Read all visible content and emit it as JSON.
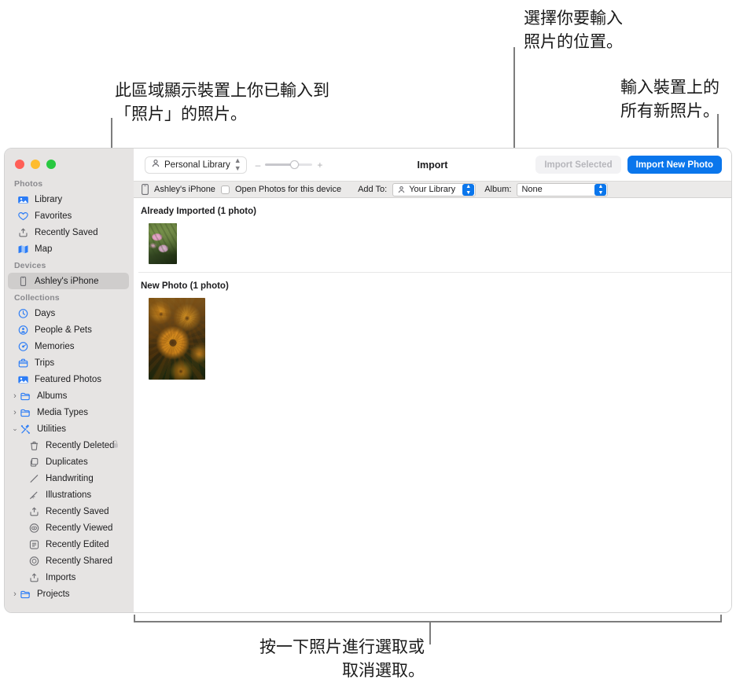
{
  "annotations": {
    "left_top": "此區域顯示裝置上你已輸入到\n「照片」的照片。",
    "top_center": "選擇你要輸入\n照片的位置。",
    "top_right": "輸入裝置上的\n所有新照片。",
    "bottom": "按一下照片進行選取或\n取消選取。"
  },
  "window": {
    "traffic_lights": [
      "close",
      "minimize",
      "zoom"
    ],
    "toolbar": {
      "library_popup": "Personal Library",
      "zoom_minus": "–",
      "zoom_plus": "+",
      "title": "Import",
      "import_selected_label": "Import Selected",
      "import_new_label": "Import New Photo",
      "accent_color": "#0a76ec"
    },
    "import_bar": {
      "device_name": "Ashley's iPhone",
      "open_photos_checkbox_label": "Open Photos for this device",
      "open_photos_checked": false,
      "add_to_label": "Add To:",
      "add_to_value": "Your Library",
      "album_label": "Album:",
      "album_value": "None"
    },
    "sidebar": {
      "sections": [
        {
          "title": "Photos",
          "items": [
            {
              "label": "Library",
              "icon": "library-icon",
              "indent": false,
              "disclosure": null,
              "selected": false
            },
            {
              "label": "Favorites",
              "icon": "heart-icon",
              "indent": false,
              "disclosure": null,
              "selected": false
            },
            {
              "label": "Recently Saved",
              "icon": "tray-up-icon",
              "indent": false,
              "disclosure": null,
              "selected": false
            },
            {
              "label": "Map",
              "icon": "map-icon",
              "indent": false,
              "disclosure": null,
              "selected": false
            }
          ]
        },
        {
          "title": "Devices",
          "items": [
            {
              "label": "Ashley's iPhone",
              "icon": "iphone-icon",
              "indent": false,
              "disclosure": null,
              "selected": true
            }
          ]
        },
        {
          "title": "Collections",
          "items": [
            {
              "label": "Days",
              "icon": "clock-icon",
              "indent": false,
              "disclosure": null,
              "selected": false
            },
            {
              "label": "People & Pets",
              "icon": "person-icon",
              "indent": false,
              "disclosure": null,
              "selected": false
            },
            {
              "label": "Memories",
              "icon": "memories-icon",
              "indent": false,
              "disclosure": null,
              "selected": false
            },
            {
              "label": "Trips",
              "icon": "suitcase-icon",
              "indent": false,
              "disclosure": null,
              "selected": false
            },
            {
              "label": "Featured Photos",
              "icon": "featured-icon",
              "indent": false,
              "disclosure": null,
              "selected": false
            },
            {
              "label": "Albums",
              "icon": "folder-icon",
              "indent": false,
              "disclosure": "right",
              "selected": false
            },
            {
              "label": "Media Types",
              "icon": "folder-icon",
              "indent": false,
              "disclosure": "right",
              "selected": false
            },
            {
              "label": "Utilities",
              "icon": "tools-icon",
              "indent": false,
              "disclosure": "down",
              "selected": false
            },
            {
              "label": "Recently Deleted",
              "icon": "trash-icon",
              "indent": true,
              "disclosure": null,
              "selected": false,
              "badge": "lock-icon"
            },
            {
              "label": "Duplicates",
              "icon": "duplicate-icon",
              "indent": true,
              "disclosure": null,
              "selected": false
            },
            {
              "label": "Handwriting",
              "icon": "pen-icon",
              "indent": true,
              "disclosure": null,
              "selected": false
            },
            {
              "label": "Illustrations",
              "icon": "illustration-icon",
              "indent": true,
              "disclosure": null,
              "selected": false
            },
            {
              "label": "Recently Saved",
              "icon": "tray-up-icon",
              "indent": true,
              "disclosure": null,
              "selected": false
            },
            {
              "label": "Recently Viewed",
              "icon": "eye-circle-icon",
              "indent": true,
              "disclosure": null,
              "selected": false
            },
            {
              "label": "Recently Edited",
              "icon": "edit-square-icon",
              "indent": true,
              "disclosure": null,
              "selected": false
            },
            {
              "label": "Recently Shared",
              "icon": "share-circle-icon",
              "indent": true,
              "disclosure": null,
              "selected": false
            },
            {
              "label": "Imports",
              "icon": "tray-up-icon",
              "indent": true,
              "disclosure": null,
              "selected": false
            },
            {
              "label": "Projects",
              "icon": "folder-icon",
              "indent": false,
              "disclosure": "right",
              "selected": false
            }
          ]
        }
      ]
    },
    "content": {
      "groups": [
        {
          "heading": "Already Imported (1 photo)",
          "photos": [
            {
              "name": "pink-flowers-photo",
              "size": "small"
            }
          ]
        },
        {
          "heading": "New Photo (1 photo)",
          "photos": [
            {
              "name": "orange-flowers-photo",
              "size": "big"
            }
          ]
        }
      ]
    }
  }
}
